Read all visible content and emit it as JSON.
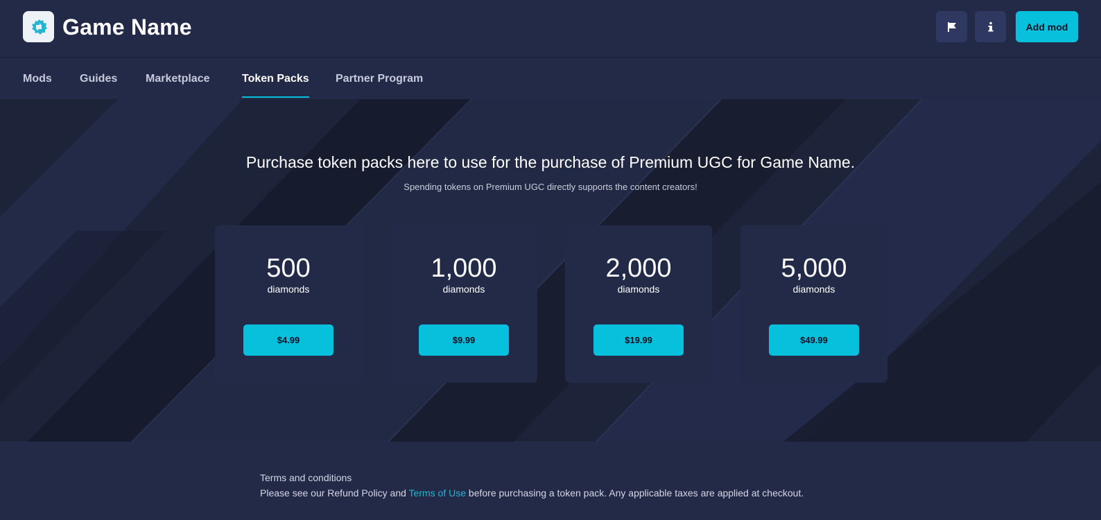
{
  "header": {
    "title": "Game Name",
    "logo_icon": "gear-puzzle-icon",
    "flag_icon": "flag-icon",
    "info_icon": "info-icon",
    "add_mod_label": "Add mod"
  },
  "nav": {
    "items": [
      {
        "label": "Mods",
        "active": false
      },
      {
        "label": "Guides",
        "active": false
      },
      {
        "label": "Marketplace",
        "active": false
      },
      {
        "label": "Token Packs",
        "active": true
      },
      {
        "label": "Partner Program",
        "active": false
      }
    ]
  },
  "hero": {
    "title": "Purchase token packs here to use for the purchase of Premium UGC for Game Name.",
    "subtitle": "Spending tokens on Premium UGC directly supports the content creators!"
  },
  "packs": [
    {
      "amount": "500",
      "unit": "diamonds",
      "price": "$4.99"
    },
    {
      "amount": "1,000",
      "unit": "diamonds",
      "price": "$9.99"
    },
    {
      "amount": "2,000",
      "unit": "diamonds",
      "price": "$19.99"
    },
    {
      "amount": "5,000",
      "unit": "diamonds",
      "price": "$49.99"
    }
  ],
  "footer": {
    "heading": "Terms and conditions",
    "text_before": "Please see our Refund Policy and ",
    "link": "Terms of Use",
    "text_after": " before purchasing a token pack. Any applicable taxes are applied at checkout."
  },
  "colors": {
    "accent": "#07c0db",
    "background": "#1f2640",
    "panel": "#232a48",
    "link": "#27b4d3"
  }
}
